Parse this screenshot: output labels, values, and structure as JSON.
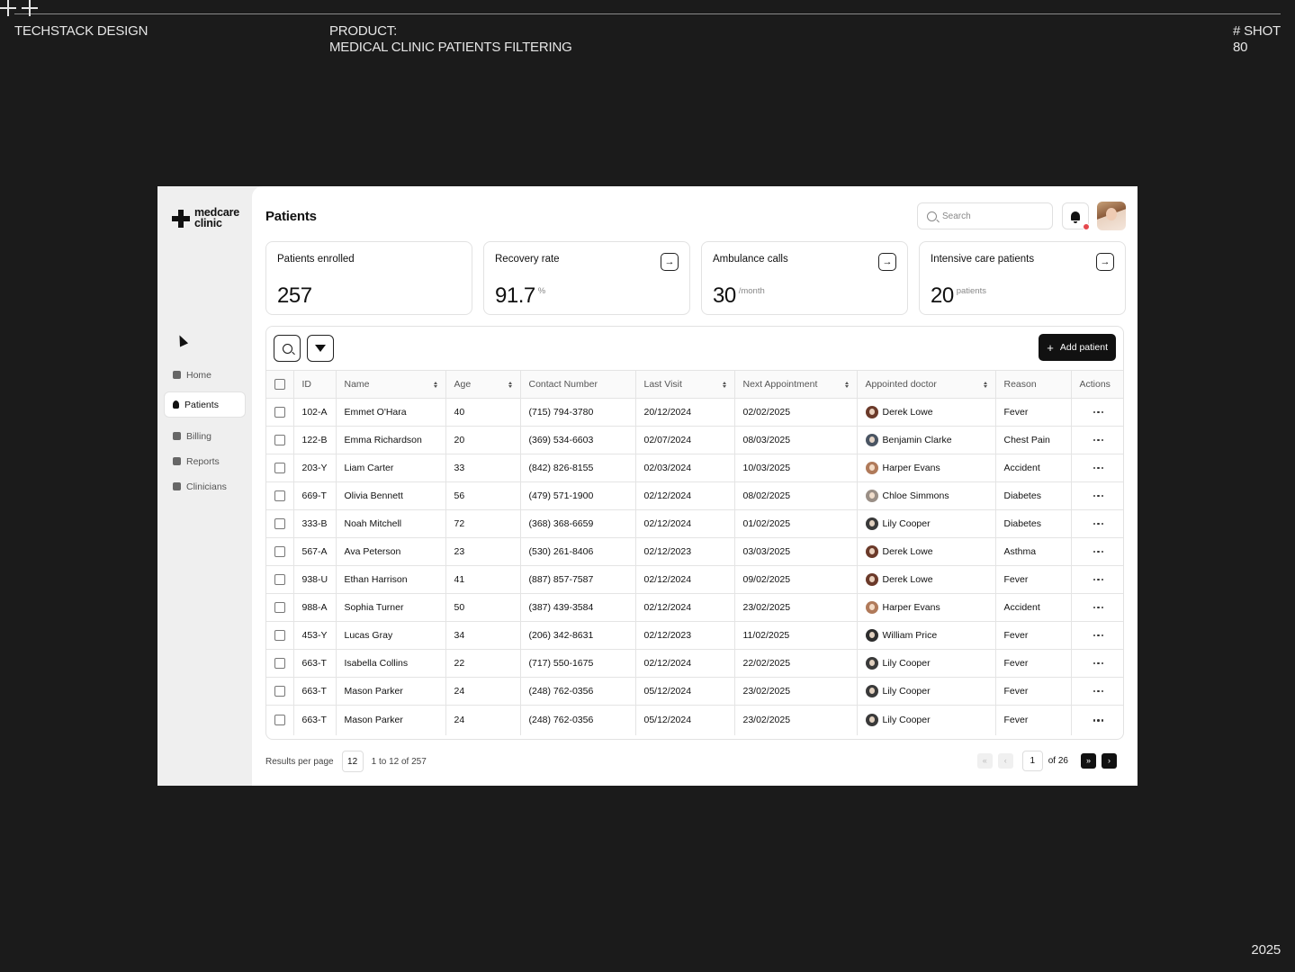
{
  "frame": {
    "studio": "TECHSTACK DESIGN",
    "product_label": "PRODUCT:",
    "product_name": "MEDICAL CLINIC PATIENTS FILTERING",
    "shot_label": "# SHOT",
    "shot_number": "80",
    "year": "2025"
  },
  "app": {
    "logo_line1": "medcare",
    "logo_line2": "clinic",
    "nav": [
      {
        "label": "Home",
        "icon": "home-icon",
        "active": false
      },
      {
        "label": "Patients",
        "icon": "user-icon",
        "active": true
      },
      {
        "label": "Billing",
        "icon": "billing-icon",
        "active": false
      },
      {
        "label": "Reports",
        "icon": "clipboard-icon",
        "active": false
      },
      {
        "label": "Clinicians",
        "icon": "building-icon",
        "active": false
      }
    ],
    "page_title": "Patients",
    "search_placeholder": "Search"
  },
  "cards": [
    {
      "title": "Patients enrolled",
      "value": "257",
      "unit": "",
      "arrow": false
    },
    {
      "title": "Recovery rate",
      "value": "91.7",
      "unit": "%",
      "arrow": true
    },
    {
      "title": "Ambulance calls",
      "value": "30",
      "unit": "/month",
      "arrow": true
    },
    {
      "title": "Intensive care patients",
      "value": "20",
      "unit": "patients",
      "arrow": true
    }
  ],
  "table": {
    "add_button": "Add patient",
    "columns": [
      "ID",
      "Name",
      "Age",
      "Contact Number",
      "Last Visit",
      "Next Appointment",
      "Appointed doctor",
      "Reason",
      "Actions"
    ],
    "rows": [
      [
        "102-A",
        "Emmet O'Hara",
        "40",
        "(715) 794-3780",
        "20/12/2024",
        "02/02/2025",
        "Derek Lowe",
        "Fever"
      ],
      [
        "122-B",
        "Emma Richardson",
        "20",
        "(369) 534-6603",
        "02/07/2024",
        "08/03/2025",
        "Benjamin Clarke",
        "Chest Pain"
      ],
      [
        "203-Y",
        "Liam Carter",
        "33",
        "(842) 826-8155",
        "02/03/2024",
        "10/03/2025",
        "Harper Evans",
        "Accident"
      ],
      [
        "669-T",
        "Olivia Bennett",
        "56",
        "(479) 571-1900",
        "02/12/2024",
        "08/02/2025",
        "Chloe Simmons",
        "Diabetes"
      ],
      [
        "333-B",
        "Noah Mitchell",
        "72",
        "(368) 368-6659",
        "02/12/2024",
        "01/02/2025",
        "Lily Cooper",
        "Diabetes"
      ],
      [
        "567-A",
        "Ava Peterson",
        "23",
        "(530) 261-8406",
        "02/12/2023",
        "03/03/2025",
        "Derek Lowe",
        "Asthma"
      ],
      [
        "938-U",
        "Ethan Harrison",
        "41",
        "(887) 857-7587",
        "02/12/2024",
        "09/02/2025",
        "Derek Lowe",
        "Fever"
      ],
      [
        "988-A",
        "Sophia Turner",
        "50",
        "(387) 439-3584",
        "02/12/2024",
        "23/02/2025",
        "Harper Evans",
        "Accident"
      ],
      [
        "453-Y",
        "Lucas Gray",
        "34",
        "(206) 342-8631",
        "02/12/2023",
        "11/02/2025",
        "William Price",
        "Fever"
      ],
      [
        "663-T",
        "Isabella Collins",
        "22",
        "(717) 550-1675",
        "02/12/2024",
        "22/02/2025",
        "Lily Cooper",
        "Fever"
      ],
      [
        "663-T",
        "Mason Parker",
        "24",
        "(248) 762-0356",
        "05/12/2024",
        "23/02/2025",
        "Lily Cooper",
        "Fever"
      ],
      [
        "663-T",
        "Mason Parker",
        "24",
        "(248) 762-0356",
        "05/12/2024",
        "23/02/2025",
        "Lily Cooper",
        "Fever"
      ]
    ],
    "doctor_colors": {
      "Derek Lowe": "#6b3a2a",
      "Benjamin Clarke": "#4a5563",
      "Harper Evans": "#b07a5a",
      "Chloe Simmons": "#9a8f86",
      "Lily Cooper": "#3a3a3a",
      "William Price": "#2e2e2e"
    }
  },
  "pagination": {
    "results_label": "Results per page",
    "per_page": "12",
    "range": "1 to 12 of 257",
    "current_page": "1",
    "of_pages": "of 26"
  }
}
